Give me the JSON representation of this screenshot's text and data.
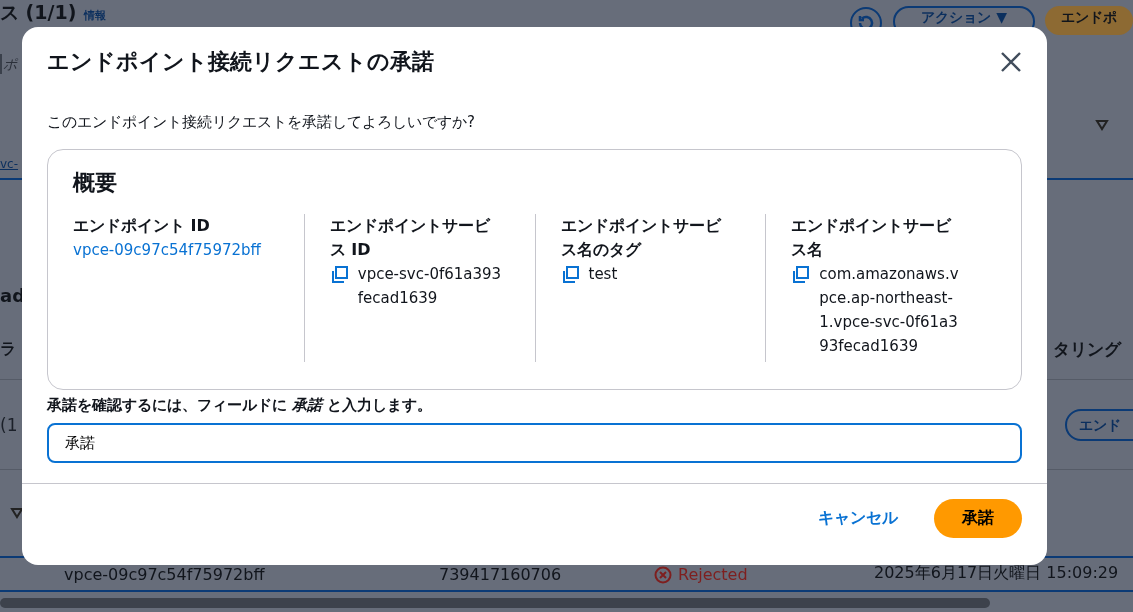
{
  "background": {
    "heading": "ス (1/1)",
    "info_link": "情報",
    "actions_button": "アクション ▼",
    "create_button": "エンドポ",
    "search_placeholder": "ポ",
    "link": "vc-",
    "section_heading": "ad",
    "left_label": "ラ",
    "right_label": "タリング",
    "count": "(1",
    "secondary_button": "エンド",
    "row": {
      "id": "vpce-09c97c54f75972bff",
      "owner": "739417160706",
      "status": "Rejected",
      "date": "2025年6月17日火曜日 15:09:29"
    }
  },
  "dialog": {
    "title": "エンドポイント接続リクエストの承諾",
    "question": "このエンドポイント接続リクエストを承諾してよろしいですか?",
    "summary_title": "概要",
    "fields": [
      {
        "label": "エンドポイント ID",
        "value": "vpce-09c97c54f75972bff",
        "kind": "link"
      },
      {
        "label": "エンドポイントサービス ID",
        "value": "vpce-svc-0f61a393fecad1639",
        "kind": "copy"
      },
      {
        "label": "エンドポイントサービス名のタグ",
        "value": "test",
        "kind": "copy"
      },
      {
        "label": "エンドポイントサービス名",
        "value": "com.amazonaws.vpce.ap-northeast-1.vpce-svc-0f61a393fecad1639",
        "kind": "copy"
      }
    ],
    "confirm_label": "承諾を確認するには、フィールドに *承諾* と入力します。",
    "confirm_value": "承諾",
    "cancel_button": "キャンセル",
    "accept_button": "承諾"
  }
}
